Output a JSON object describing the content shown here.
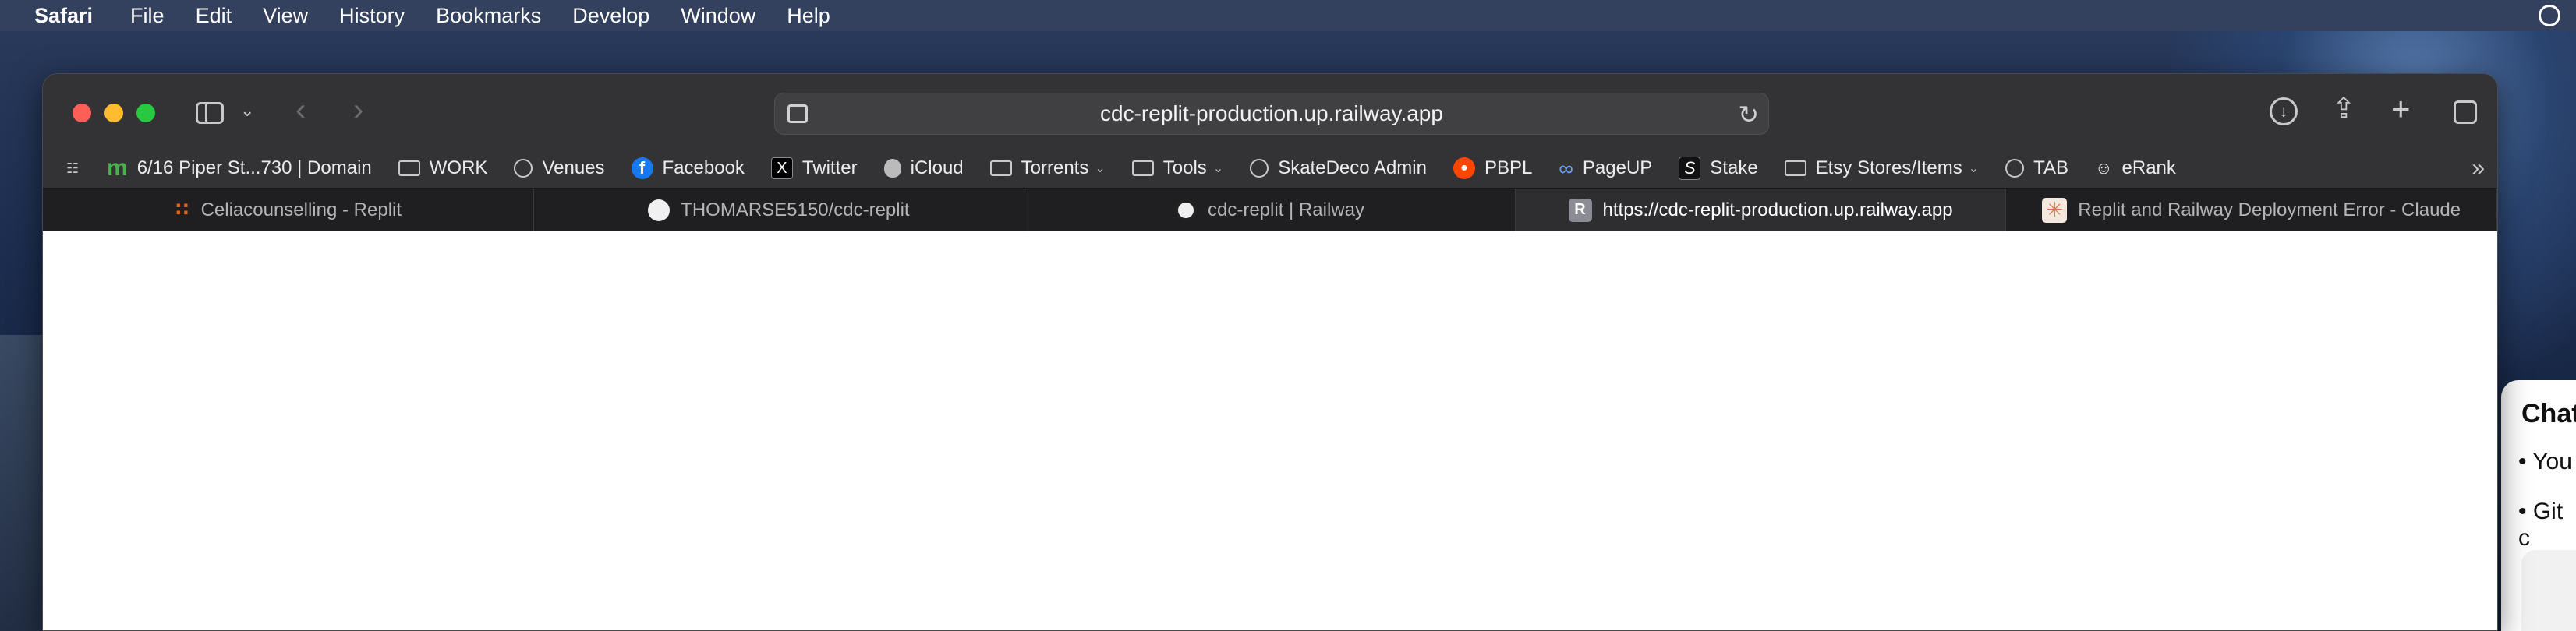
{
  "menubar": {
    "app": "Safari",
    "items": [
      "File",
      "Edit",
      "View",
      "History",
      "Bookmarks",
      "Develop",
      "Window",
      "Help"
    ]
  },
  "toolbar": {
    "url": "cdc-replit-production.up.railway.app"
  },
  "bookmarks": [
    {
      "label": "6/16 Piper St...730 | Domain",
      "icon": "m"
    },
    {
      "label": "WORK",
      "icon": "folder"
    },
    {
      "label": "Venues",
      "icon": "globe"
    },
    {
      "label": "Facebook",
      "icon": "facebook"
    },
    {
      "label": "Twitter",
      "icon": "x"
    },
    {
      "label": "iCloud",
      "icon": "apple"
    },
    {
      "label": "Torrents",
      "icon": "folder"
    },
    {
      "label": "Tools",
      "icon": "folder"
    },
    {
      "label": "SkateDeco Admin",
      "icon": "globe"
    },
    {
      "label": "PBPL",
      "icon": "reddit"
    },
    {
      "label": "PageUP",
      "icon": "pageup"
    },
    {
      "label": "Stake",
      "icon": "stake"
    },
    {
      "label": "Etsy Stores/Items",
      "icon": "folder"
    },
    {
      "label": "TAB",
      "icon": "globe"
    },
    {
      "label": "eRank",
      "icon": "emoji"
    }
  ],
  "tabs": [
    {
      "label": "Celiacounselling - Replit"
    },
    {
      "label": "THOMARSE5150/cdc-replit"
    },
    {
      "label": "cdc-replit | Railway"
    },
    {
      "label": "https://cdc-replit-production.up.railway.app"
    },
    {
      "label": "Replit and Railway Deployment Error - Claude"
    }
  ],
  "chat_panel": {
    "title": "Chat",
    "bullet1": "You",
    "bullet2": "Git c"
  }
}
